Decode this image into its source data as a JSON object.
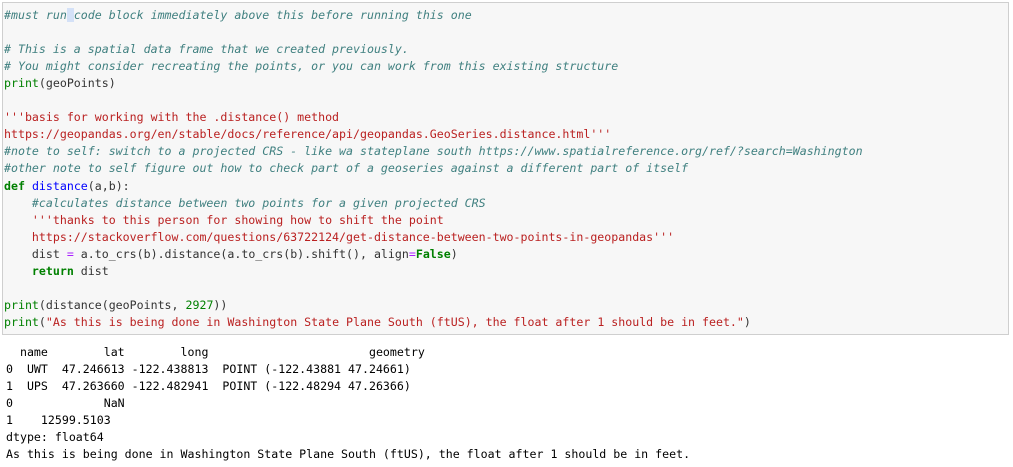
{
  "input_lines": [
    {
      "tokens": [
        {
          "t": "#must run",
          "c": "cm"
        },
        {
          "t": " ",
          "c": "cm cursor"
        },
        {
          "t": "code block immediately above this before running this one",
          "c": "cm"
        }
      ]
    },
    {
      "tokens": []
    },
    {
      "tokens": [
        {
          "t": "# This is a spatial data frame that we created previously.",
          "c": "cm"
        }
      ]
    },
    {
      "tokens": [
        {
          "t": "# You might consider recreating the points, or you can work from this existing structure",
          "c": "cm"
        }
      ]
    },
    {
      "tokens": [
        {
          "t": "print",
          "c": "bi"
        },
        {
          "t": "(geoPoints)",
          "c": "tx"
        }
      ]
    },
    {
      "tokens": []
    },
    {
      "tokens": [
        {
          "t": "'''basis for working with the .distance() method",
          "c": "st"
        }
      ]
    },
    {
      "tokens": [
        {
          "t": "https://geopandas.org/en/stable/docs/reference/api/geopandas.GeoSeries.distance.html'''",
          "c": "st"
        }
      ]
    },
    {
      "tokens": [
        {
          "t": "#note to self: switch to a projected CRS - like wa stateplane south https://www.spatialreference.org/ref/?search=Washington",
          "c": "cm"
        }
      ]
    },
    {
      "tokens": [
        {
          "t": "#other note to self figure out how to check part of a geoseries against a different part of itself",
          "c": "cm"
        }
      ]
    },
    {
      "tokens": [
        {
          "t": "def",
          "c": "kw"
        },
        {
          "t": " ",
          "c": "tx"
        },
        {
          "t": "distance",
          "c": "fn"
        },
        {
          "t": "(a,b):",
          "c": "tx"
        }
      ]
    },
    {
      "tokens": [
        {
          "t": "    ",
          "c": "tx"
        },
        {
          "t": "#calculates distance between two points for a given projected CRS",
          "c": "cm"
        }
      ]
    },
    {
      "tokens": [
        {
          "t": "    '''thanks to this person for showing how to shift the point",
          "c": "st"
        }
      ]
    },
    {
      "tokens": [
        {
          "t": "    https://stackoverflow.com/questions/63722124/get-distance-between-two-points-in-geopandas'''",
          "c": "st"
        }
      ]
    },
    {
      "tokens": [
        {
          "t": "    dist ",
          "c": "tx"
        },
        {
          "t": "=",
          "c": "op"
        },
        {
          "t": " a.to_crs(b).distance(a.to_crs(b).shift(), align",
          "c": "tx"
        },
        {
          "t": "=",
          "c": "op"
        },
        {
          "t": "False",
          "c": "kw"
        },
        {
          "t": ")",
          "c": "tx"
        }
      ]
    },
    {
      "tokens": [
        {
          "t": "    ",
          "c": "tx"
        },
        {
          "t": "return",
          "c": "kw"
        },
        {
          "t": " dist",
          "c": "tx"
        }
      ]
    },
    {
      "tokens": []
    },
    {
      "tokens": [
        {
          "t": "print",
          "c": "bi"
        },
        {
          "t": "(distance(geoPoints, ",
          "c": "tx"
        },
        {
          "t": "2927",
          "c": "nm"
        },
        {
          "t": "))",
          "c": "tx"
        }
      ]
    },
    {
      "tokens": [
        {
          "t": "print",
          "c": "bi"
        },
        {
          "t": "(",
          "c": "tx"
        },
        {
          "t": "\"As this is being done in Washington State Plane South (ftUS), the float after 1 should be in feet.\"",
          "c": "st"
        },
        {
          "t": ")",
          "c": "tx"
        }
      ]
    }
  ],
  "output_lines": [
    "  name        lat        long                       geometry",
    "0  UWT  47.246613 -122.438813  POINT (-122.43881 47.24661)",
    "1  UPS  47.263660 -122.482941  POINT (-122.48294 47.26366)",
    "0             NaN",
    "1    12599.5103",
    "dtype: float64",
    "As this is being done in Washington State Plane South (ftUS), the float after 1 should be in feet."
  ]
}
